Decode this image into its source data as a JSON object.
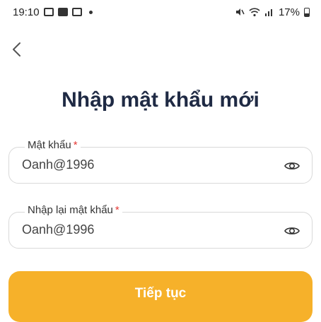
{
  "status_bar": {
    "time": "19:10",
    "battery": "17%"
  },
  "page": {
    "title": "Nhập mật khẩu mới"
  },
  "password_field": {
    "label": "Mật khẩu",
    "required_mark": "*",
    "value": "Oanh@1996"
  },
  "confirm_field": {
    "label": "Nhập lại mật khẩu",
    "required_mark": "*",
    "value": "Oanh@1996"
  },
  "continue_button": {
    "label": "Tiếp tục"
  },
  "colors": {
    "accent": "#f6b12a",
    "title": "#1f2a44",
    "required": "#e53935"
  }
}
